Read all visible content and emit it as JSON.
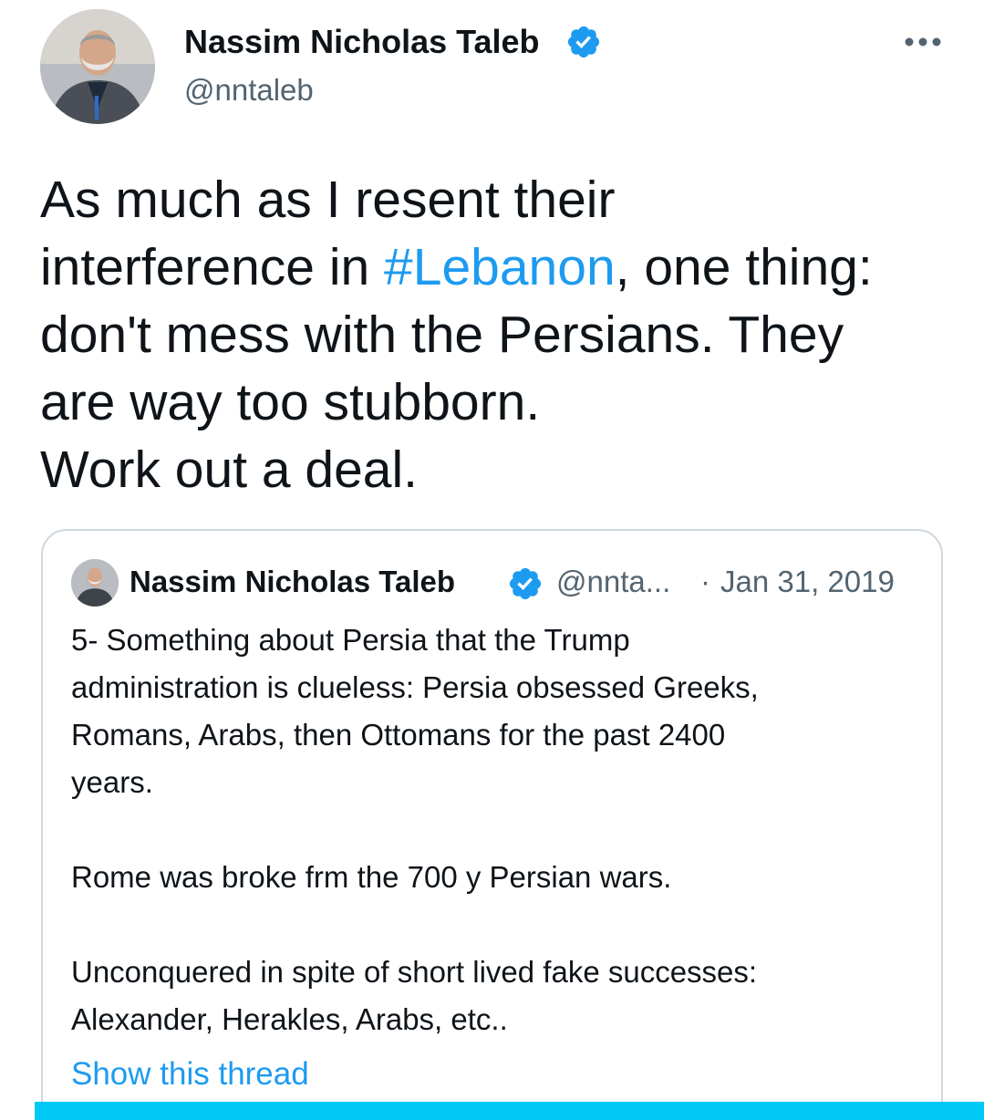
{
  "author": {
    "name": "Nassim Nicholas Taleb",
    "handle": "@nntaleb",
    "avatar_icon": "profile-photo",
    "verified_icon": "verified-badge-icon"
  },
  "more_icon": "more-options-icon",
  "tweet": {
    "lines": [
      "As much as I resent their",
      {
        "pre": "interference in ",
        "hashtag": "#Lebanon",
        "post": ", one thing:"
      },
      "don't mess with the Persians. They",
      "are way too stubborn.",
      "Work out a deal."
    ]
  },
  "quote": {
    "name": "Nassim Nicholas Taleb",
    "handle": "@nnta...",
    "dot": "·",
    "date": "Jan 31, 2019",
    "lines": [
      "5- Something about Persia that the Trump",
      "administration is clueless: Persia obsessed Greeks,",
      "Romans, Arabs, then Ottomans for the past 2400",
      "years.",
      "",
      "Rome was broke frm the 700 y Persian wars.",
      "",
      "Unconquered in spite of short lived fake successes:",
      "Alexander, Herakles, Arabs, etc.."
    ],
    "show_thread": "Show this thread"
  },
  "colors": {
    "link": "#1d9bf0",
    "secondary_text": "#536471",
    "border": "#cfd9de",
    "bottom_bar": "#00c8f5"
  }
}
